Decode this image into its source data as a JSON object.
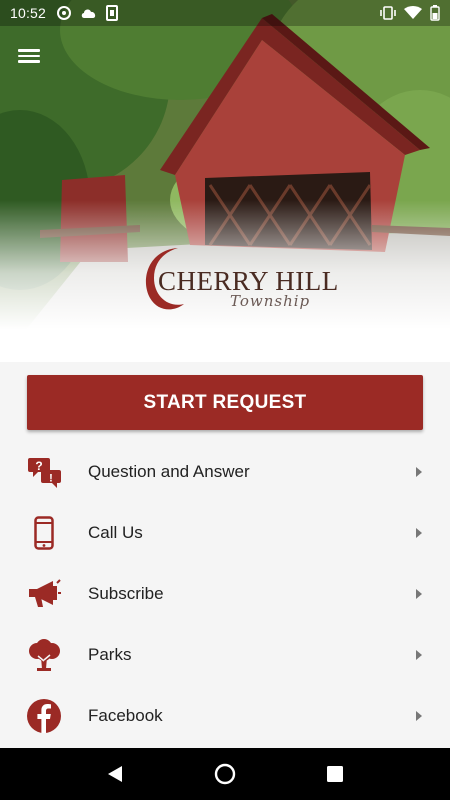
{
  "status_bar": {
    "time": "10:52",
    "left_icons": [
      "at-sign-icon",
      "cloud-icon",
      "sd-card-icon"
    ],
    "right_icons": [
      "vibrate-icon",
      "wifi-icon",
      "battery-icon"
    ]
  },
  "header": {
    "menu_icon": "hamburger-menu-icon",
    "logo_text": "CHERRY HILL",
    "logo_subtext": "Township"
  },
  "start_request": {
    "label": "START REQUEST",
    "color": "#9b2a25"
  },
  "menu_items": [
    {
      "label": "Question and Answer",
      "icon": "question-answer-icon"
    },
    {
      "label": "Call Us",
      "icon": "phone-icon"
    },
    {
      "label": "Subscribe",
      "icon": "megaphone-icon"
    },
    {
      "label": "Parks",
      "icon": "tree-icon"
    },
    {
      "label": "Facebook",
      "icon": "facebook-icon"
    }
  ],
  "accent_color": "#9b2a25",
  "nav_bar": {
    "buttons": [
      "back-icon",
      "home-icon",
      "recents-icon"
    ]
  }
}
